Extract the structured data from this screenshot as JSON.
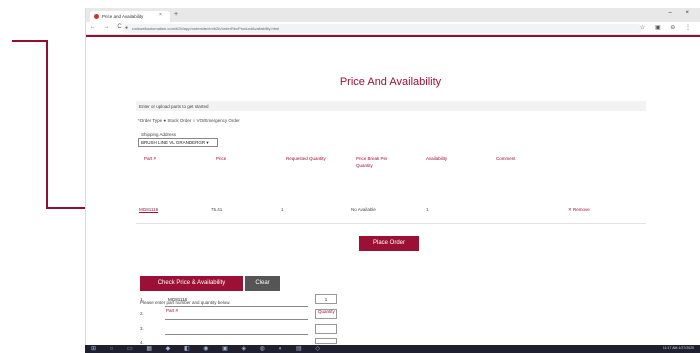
{
  "browser": {
    "tab_title": "Price and Availability",
    "tab_close": "×",
    "new_tab": "+",
    "window_controls": "– ×",
    "nav_icons": "← → C ⌂",
    "url": "rockwellautomation.com/b2b/app/ordersite/en/b2b/orderRecProductAvailability.html",
    "toolbar_right": "☆ ▣ ⊖ ⋮"
  },
  "page": {
    "title": "Price And Availability",
    "section_header": "Enter or upload parts to get started",
    "order_type_text": "*Order Type ● Stock Order ○ VO/Emergency Order",
    "shipping_label": "Shipping Address",
    "shipping_value": "BRUSH LINE VL GRANDERGR ▾"
  },
  "results_table": {
    "headers": [
      {
        "key": "part",
        "label": "Part #"
      },
      {
        "key": "price",
        "label": "Price"
      },
      {
        "key": "requested",
        "label": "Requested Quantity"
      },
      {
        "key": "break",
        "label": "Price Break Per Quantity"
      },
      {
        "key": "availability",
        "label": "Availability"
      },
      {
        "key": "comment",
        "label": "Comment"
      }
    ],
    "rows": [
      {
        "part": "MG81116",
        "price": "75.41",
        "requested": "1",
        "break": "No Available",
        "availability": "1",
        "comment": "",
        "remove": "✕ Remove"
      }
    ]
  },
  "actions": {
    "place_order": "Place Order",
    "check_price": "Check Price & Availability",
    "clear": "Clear"
  },
  "entry": {
    "hint": "Please enter part number and quantity below.",
    "part_header": "Part #",
    "qty_header": "Quantity",
    "rows": [
      {
        "num": "1.",
        "part": "MG81116",
        "qty": "1"
      },
      {
        "num": "2.",
        "part": "",
        "qty": ""
      },
      {
        "num": "3.",
        "part": "",
        "qty": ""
      },
      {
        "num": "4.",
        "part": "",
        "qty": ""
      }
    ]
  },
  "taskbar": {
    "icons": "⊞ ○ ▭ ▦ ◆ ◧ ◉ ▣ ◈ ◍ ◐ ▤ ◇",
    "clock": "11:17 AM 1/27/2020"
  },
  "colors": {
    "brand": "#9b1035",
    "annotation": "#8f1030"
  }
}
